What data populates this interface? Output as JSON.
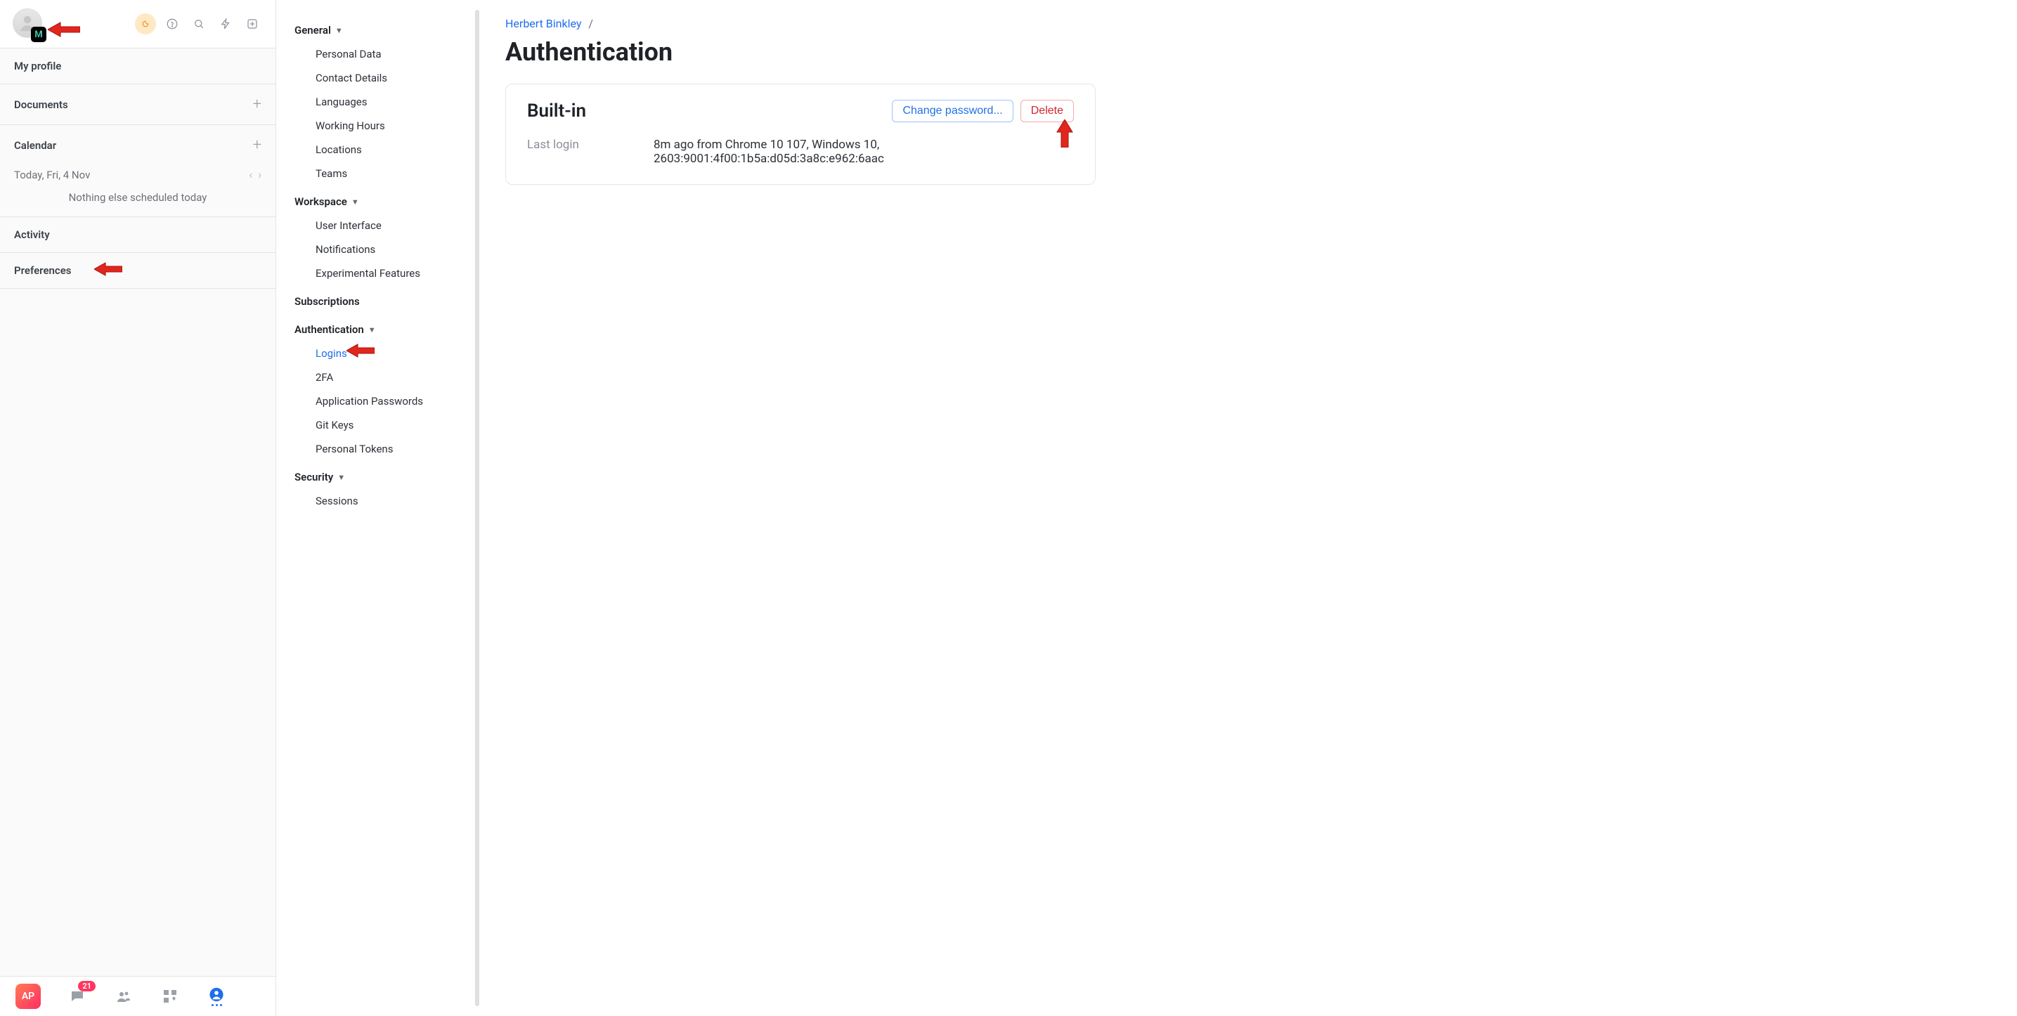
{
  "left": {
    "avatar_badge": "M",
    "my_profile": "My profile",
    "documents": "Documents",
    "calendar": "Calendar",
    "cal_date": "Today, Fri, 4 Nov",
    "cal_empty": "Nothing else scheduled today",
    "activity": "Activity",
    "preferences": "Preferences",
    "ap": "AP",
    "notif_count": "21"
  },
  "settings": {
    "general": "General",
    "general_items": {
      "personal_data": "Personal Data",
      "contact_details": "Contact Details",
      "languages": "Languages",
      "working_hours": "Working Hours",
      "locations": "Locations",
      "teams": "Teams"
    },
    "workspace": "Workspace",
    "workspace_items": {
      "ui": "User Interface",
      "notifications": "Notifications",
      "experimental": "Experimental Features"
    },
    "subscriptions": "Subscriptions",
    "authentication": "Authentication",
    "auth_items": {
      "logins": "Logins",
      "twofa": "2FA",
      "app_passwords": "Application Passwords",
      "git_keys": "Git Keys",
      "personal_tokens": "Personal Tokens"
    },
    "security": "Security",
    "security_items": {
      "sessions": "Sessions"
    }
  },
  "main": {
    "breadcrumb_user": "Herbert Binkley",
    "breadcrumb_sep": "/",
    "title": "Authentication",
    "card_title": "Built-in",
    "change_password": "Change password...",
    "delete": "Delete",
    "last_login_label": "Last login",
    "last_login_value": "8m ago from Chrome 10 107, Windows 10, 2603:9001:4f00:1b5a:d05d:3a8c:e962:6aac"
  }
}
